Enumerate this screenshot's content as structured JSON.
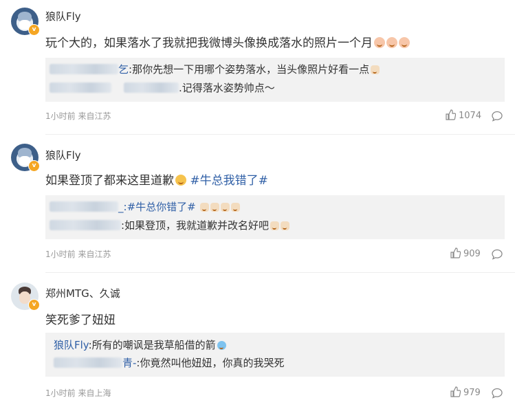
{
  "posts": [
    {
      "username": "狼队Fly",
      "content": "玩个大的，如果落水了我就把我微博头像换成落水的照片一个月",
      "hashtag": "",
      "replies": [
        {
          "name_tail": "乞",
          "text": ":那你先想一下用哪个姿势落水，当头像照片好看一点"
        },
        {
          "name_tail": "",
          "text": ".记得落水姿势帅点～"
        }
      ],
      "meta": "1小时前 来自江苏",
      "likes": "1074"
    },
    {
      "username": "狼队Fly",
      "content": "如果登顶了都来这里道歉",
      "hashtag": "#牛总我错了#",
      "replies": [
        {
          "name_tail": "_:",
          "text": "#牛总你错了#"
        },
        {
          "name_tail": "",
          "text": ":如果登顶，我就道歉并改名好吧"
        }
      ],
      "meta": "1小时前 来自江苏",
      "likes": "909"
    },
    {
      "username": "郑州MTG、久诚",
      "content": "笑死爹了妞妞",
      "hashtag": "",
      "replies": [
        {
          "name": "狼队Fly",
          "text": ":所有的嘲讽是我草船借的箭"
        },
        {
          "name_tail": "青-",
          "text": ":你竟然叫他妞妞，你真的我哭死"
        }
      ],
      "meta": "1小时前 来自上海",
      "likes": "979"
    }
  ],
  "colors": {
    "link": "#2f5fa6",
    "meta": "#999999",
    "reply_bg": "#f2f2f2",
    "badge": "#f5a623"
  }
}
